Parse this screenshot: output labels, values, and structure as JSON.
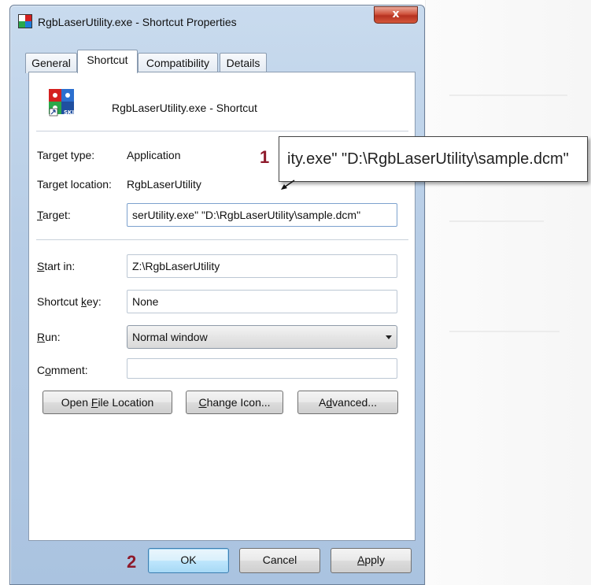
{
  "window": {
    "title": "RgbLaserUtility.exe - Shortcut Properties",
    "close_label": "x"
  },
  "tabs": [
    {
      "label": "General"
    },
    {
      "label": "Shortcut"
    },
    {
      "label": "Compatibility"
    },
    {
      "label": "Details"
    }
  ],
  "header": {
    "shortcut_name": "RgbLaserUtility.exe - Shortcut",
    "icon_text": "SKI"
  },
  "fields": {
    "target_type_label": "Target type:",
    "target_type_value": "Application",
    "target_location_label": "Target location:",
    "target_location_value": "RgbLaserUtility",
    "target_label": "Target:",
    "target_value": "serUtility.exe\" \"D:\\RgbLaserUtility\\sample.dcm\"",
    "start_in_label": "Start in:",
    "start_in_value": "Z:\\RgbLaserUtility",
    "shortcut_key_label": "Shortcut key:",
    "shortcut_key_value": "None",
    "run_label": "Run:",
    "run_value": "Normal window",
    "comment_label": "Comment:",
    "comment_value": ""
  },
  "buttons": {
    "open_file_location": "Open File Location",
    "change_icon": "Change Icon...",
    "advanced": "Advanced...",
    "ok": "OK",
    "cancel": "Cancel",
    "apply": "Apply"
  },
  "annotations": {
    "callout_text": "ity.exe\" \"D:\\RgbLaserUtility\\sample.dcm\"",
    "step1": "1",
    "step2": "2"
  },
  "colors": {
    "annotation_number": "#8e1a2b",
    "ok_button_border": "#3c7fb1",
    "close_button": "#c8402b"
  }
}
